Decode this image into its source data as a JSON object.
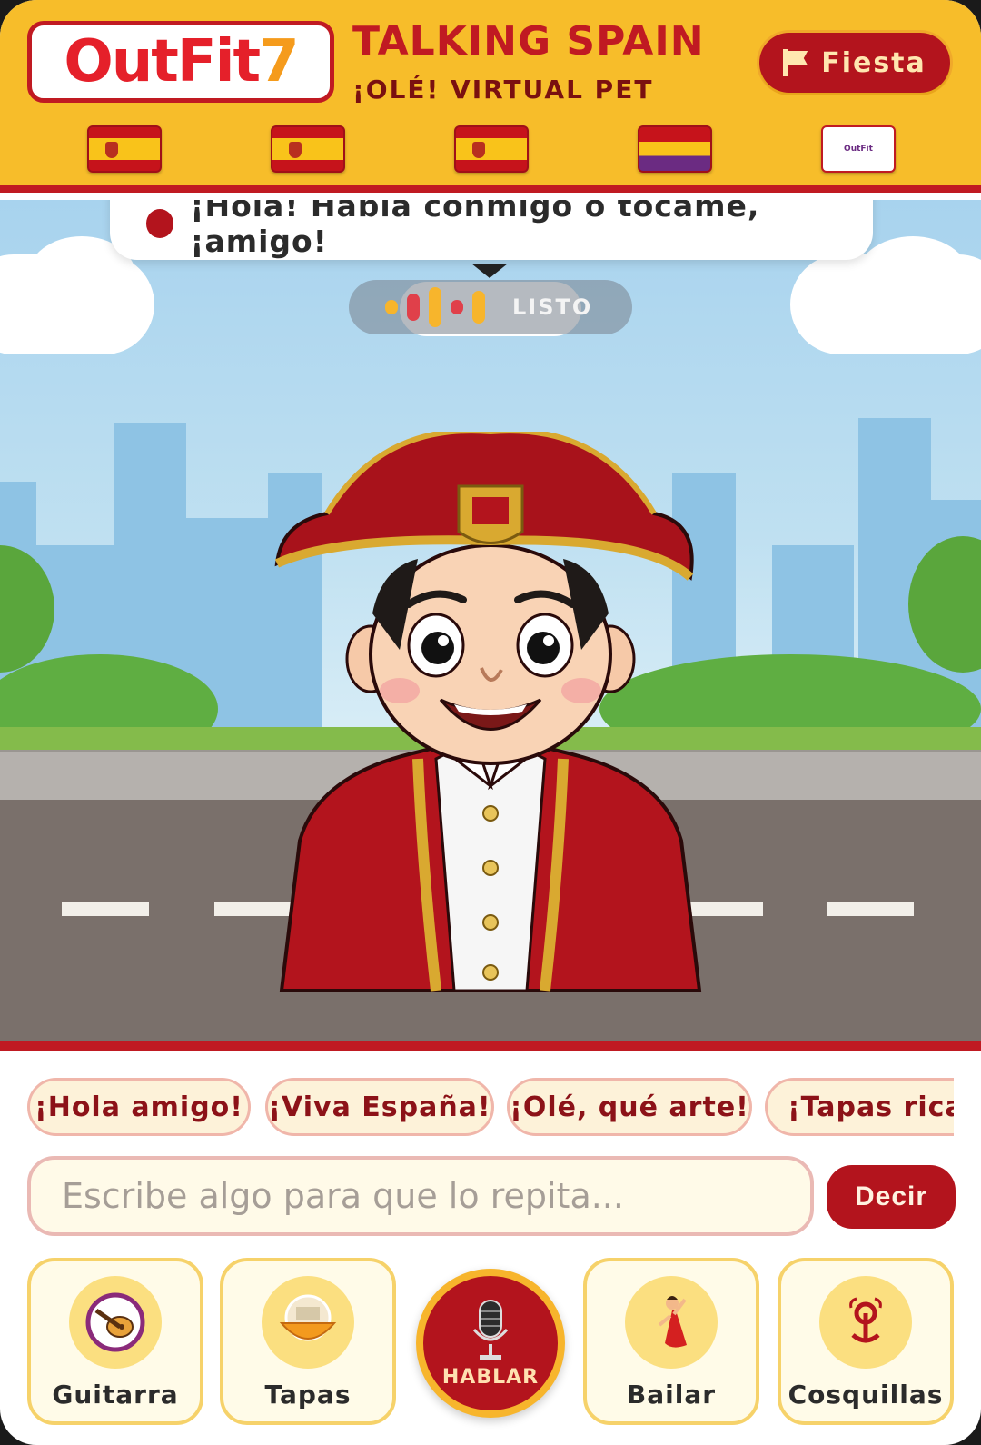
{
  "header": {
    "logo": {
      "main": "OutFit",
      "accent": "7"
    },
    "title": "TALKING SPAIN",
    "subtitle": "¡OLÉ! VIRTUAL PET",
    "fiesta_label": "Fiesta",
    "flags": [
      "flag-spain",
      "flag-spain",
      "flag-spain",
      "flag-spain-republic",
      "brand-mini-logo"
    ]
  },
  "scene": {
    "speech": "¡Hola! Habla conmigo o tócame, ¡amigo!",
    "status": "LISTO",
    "status_bar_colors": [
      "#f7b52c",
      "#e0404a",
      "#f7b52c",
      "#e0404a",
      "#f7b52c"
    ]
  },
  "phrases": [
    "¡Hola amigo!",
    "¡Viva España!",
    "¡Olé, qué arte!",
    "¡Tapas ricas!"
  ],
  "say": {
    "placeholder": "Escribe algo para que lo repita...",
    "button": "Decir"
  },
  "actions": {
    "guitar": "Guitarra",
    "tapas": "Tapas",
    "talk": "HABLAR",
    "dance": "Bailar",
    "tickle": "Cosquillas"
  },
  "colors": {
    "brand_red": "#b3141d",
    "brand_yellow": "#f7bd2a"
  }
}
